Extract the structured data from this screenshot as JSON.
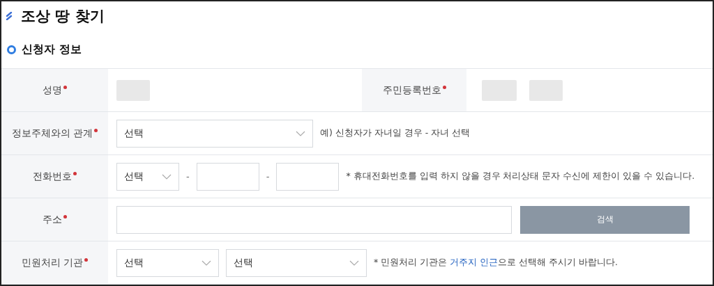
{
  "page_title": "조상 땅 찾기",
  "section_title": "신청자 정보",
  "rows": [
    {
      "kind": "pair",
      "label": "성명",
      "required": true,
      "second_label": "주민등록번호",
      "second_required": true
    },
    {
      "kind": "select_note",
      "label": "정보주체와의 관계",
      "required": true,
      "select": "선택",
      "note": "예) 신청자가 자녀일 경우 - 자녀 선택"
    },
    {
      "kind": "phone",
      "label": "전화번호",
      "required": true,
      "select": "선택",
      "separators": [
        "-",
        "-"
      ],
      "note": "* 휴대전화번호를 입력 하지 않을 경우 처리상태 문자 수신에 제한이 있을 수 있습니다."
    },
    {
      "kind": "address",
      "label": "주소",
      "required": true,
      "button": "검색"
    },
    {
      "kind": "agency",
      "label": "민원처리 기관",
      "required": true,
      "selects": [
        "선택",
        "선택"
      ],
      "note_before": "* 민원처리 기관은 ",
      "note_highlight": "거주지 인근",
      "note_after": "으로 선택해 주시기 바랍니다."
    }
  ]
}
